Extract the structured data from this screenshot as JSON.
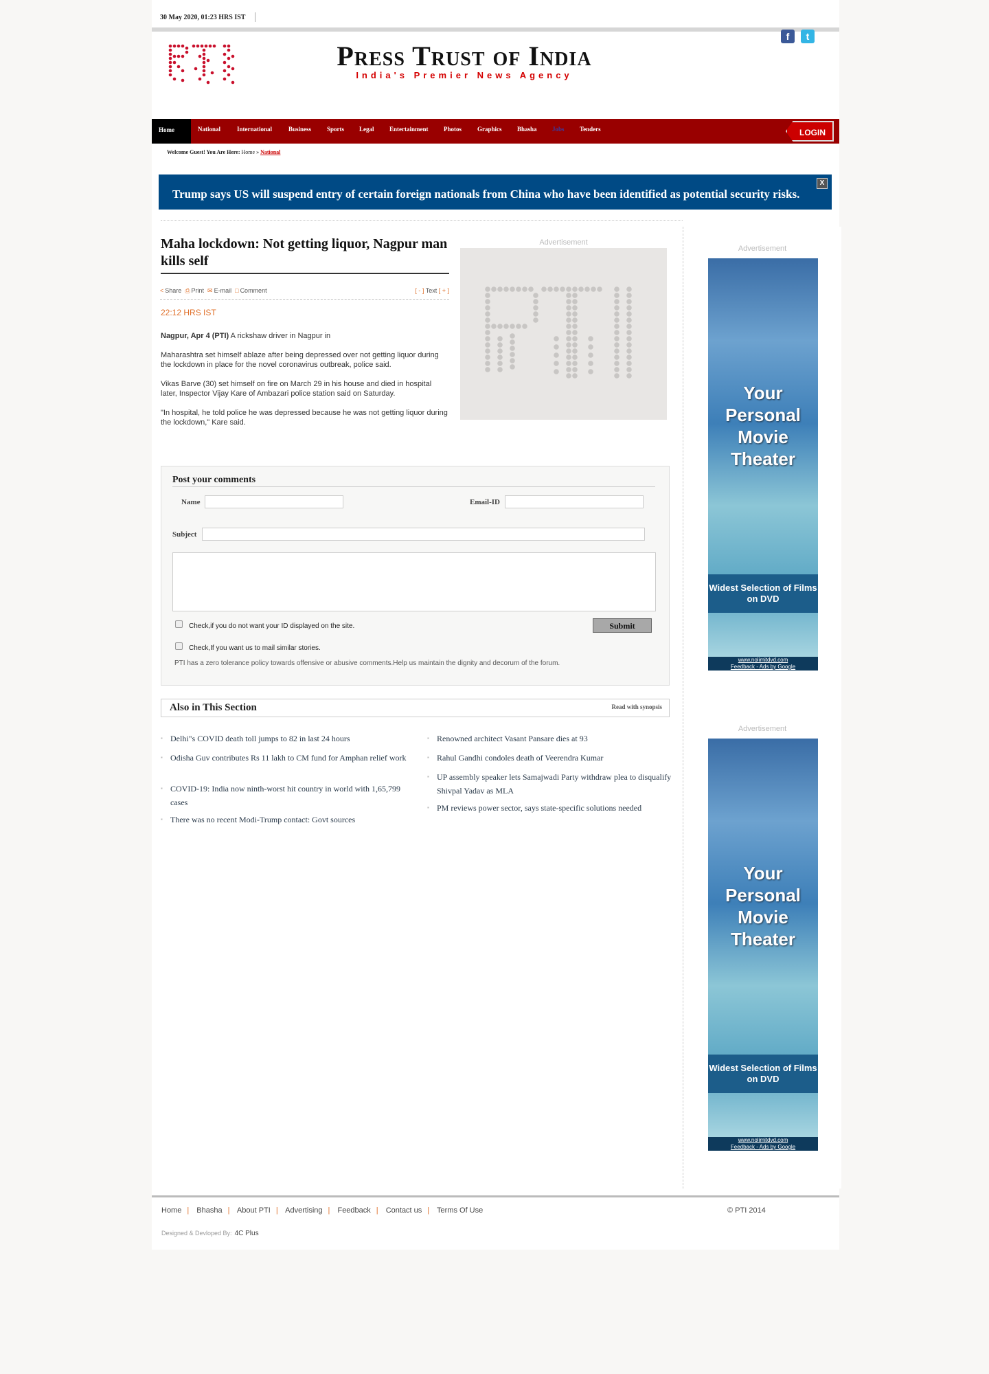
{
  "header": {
    "date": "30 May 2020, 01:23 HRS IST",
    "brand_title": "Press Trust of India",
    "brand_tagline": "India's Premier News Agency",
    "logo_text": "PTI"
  },
  "nav": {
    "items": [
      "Home",
      "National",
      "International",
      "Business",
      "Sports",
      "Legal",
      "Entertainment",
      "Photos",
      "Graphics",
      "Bhasha",
      "Jobs",
      "Tenders"
    ],
    "login": "LOGIN"
  },
  "breadcrumb": {
    "welcome": "Welcome Guest! You Are Here:",
    "home": "Home",
    "current": "National"
  },
  "ticker": {
    "text": "Trump says US will suspend entry of certain foreign nationals from China who have been identified as potential security risks.",
    "close": "X"
  },
  "article": {
    "title": "Maha lockdown: Not getting liquor, Nagpur man kills self",
    "tools": {
      "share": "Share",
      "print": "Print",
      "email": "E-mail",
      "comment": "Comment",
      "text_minus": "[ - ]",
      "text_label": "Text",
      "text_plus": "[ + ]"
    },
    "time": "22:12 HRS IST",
    "dateline": "Nagpur, Apr 4 (PTI)",
    "para1": "A rickshaw driver in Nagpur in",
    "para2": "Maharashtra set himself ablaze after being depressed over not getting liquor during the lockdown in place for the novel coronavirus outbreak, police said.",
    "para3": "Vikas Barve (30) set himself on fire on March 29 in his house and died in hospital later, Inspector Vijay Kare of Ambazari police station said on Saturday.",
    "para4": "\"In hospital, he told police he was depressed because he was not getting liquor during the lockdown,\" Kare said."
  },
  "ads": {
    "label": "Advertisement",
    "banner_big": "Your Personal Movie Theater",
    "banner_strip": "Widest Selection of Films on DVD",
    "banner_url": "www.nolimitdvd.com",
    "banner_feedback": "Feedback - Ads by Google"
  },
  "comments": {
    "heading": "Post your comments",
    "name_label": "Name",
    "email_label": "Email-ID",
    "subject_label": "Subject",
    "check1": "Check,if you do not want your ID displayed on the site.",
    "check2": "Check,If you want us to mail similar stories.",
    "submit": "Submit",
    "policy": "PTI has a zero tolerance policy towards offensive or abusive comments.Help us maintain the dignity and decorum of the forum."
  },
  "also": {
    "heading": "Also in This Section",
    "read_synopsis": "Read with synopsis",
    "left": [
      "Delhi\"s COVID death toll jumps to 82 in last 24 hours",
      "Odisha Guv contributes Rs 11 lakh to CM fund for Amphan relief work",
      "COVID-19: India now ninth-worst hit country in world with 1,65,799 cases",
      "There was no recent Modi-Trump contact: Govt sources"
    ],
    "right": [
      "Renowned architect Vasant Pansare dies at 93",
      "Rahul Gandhi condoles death of Veerendra Kumar",
      "UP assembly speaker lets Samajwadi Party withdraw plea to disqualify Shivpal Yadav as MLA",
      "PM reviews power sector, says state-specific solutions needed"
    ]
  },
  "footer": {
    "links": [
      "Home",
      "Bhasha",
      "About PTI",
      "Advertising",
      "Feedback",
      "Contact us",
      "Terms Of Use"
    ],
    "copyright": "© PTI 2014",
    "designed_by": "Designed & Devloped By:",
    "designer": "4C Plus"
  },
  "colors": {
    "nav_red": "#990000",
    "ticker_blue": "#004a85",
    "accent_orange": "#e0702a"
  }
}
